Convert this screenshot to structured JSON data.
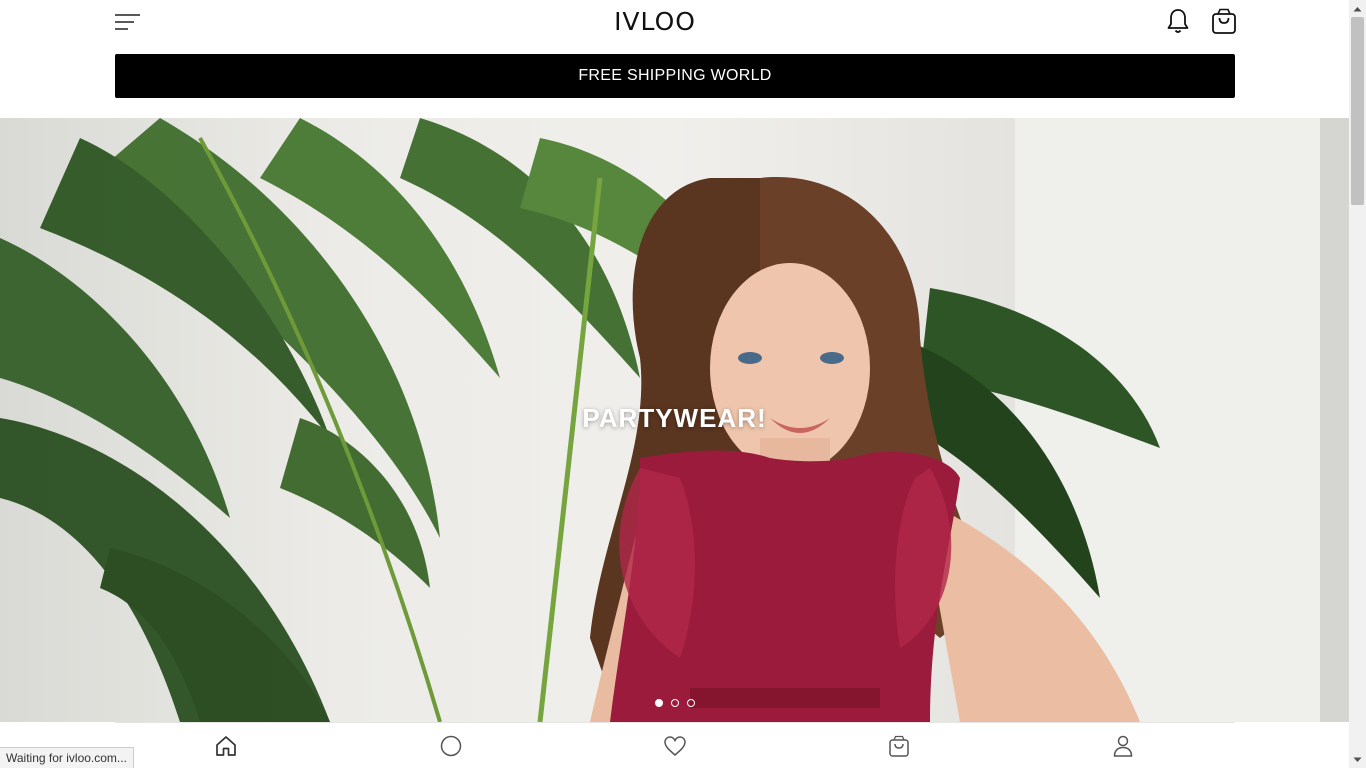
{
  "header": {
    "logo_text": "IVLOO",
    "menu_icon": "hamburger-menu-icon",
    "notification_icon": "bell-icon",
    "cart_icon": "shopping-bag-icon"
  },
  "promo": {
    "text": "FREE SHIPPING WORLD"
  },
  "hero": {
    "title": "PARTYWEAR!",
    "slides_total": 3,
    "active_slide": 1
  },
  "bottom_nav": {
    "items": [
      {
        "icon": "home-icon"
      },
      {
        "icon": "circle-icon"
      },
      {
        "icon": "heart-icon"
      },
      {
        "icon": "shopping-bag-icon"
      },
      {
        "icon": "user-icon"
      }
    ]
  },
  "status_bar": {
    "text": "Waiting for ivloo.com..."
  },
  "colors": {
    "accent": "#000000",
    "background": "#ffffff",
    "dress": "#9b1b3c"
  }
}
